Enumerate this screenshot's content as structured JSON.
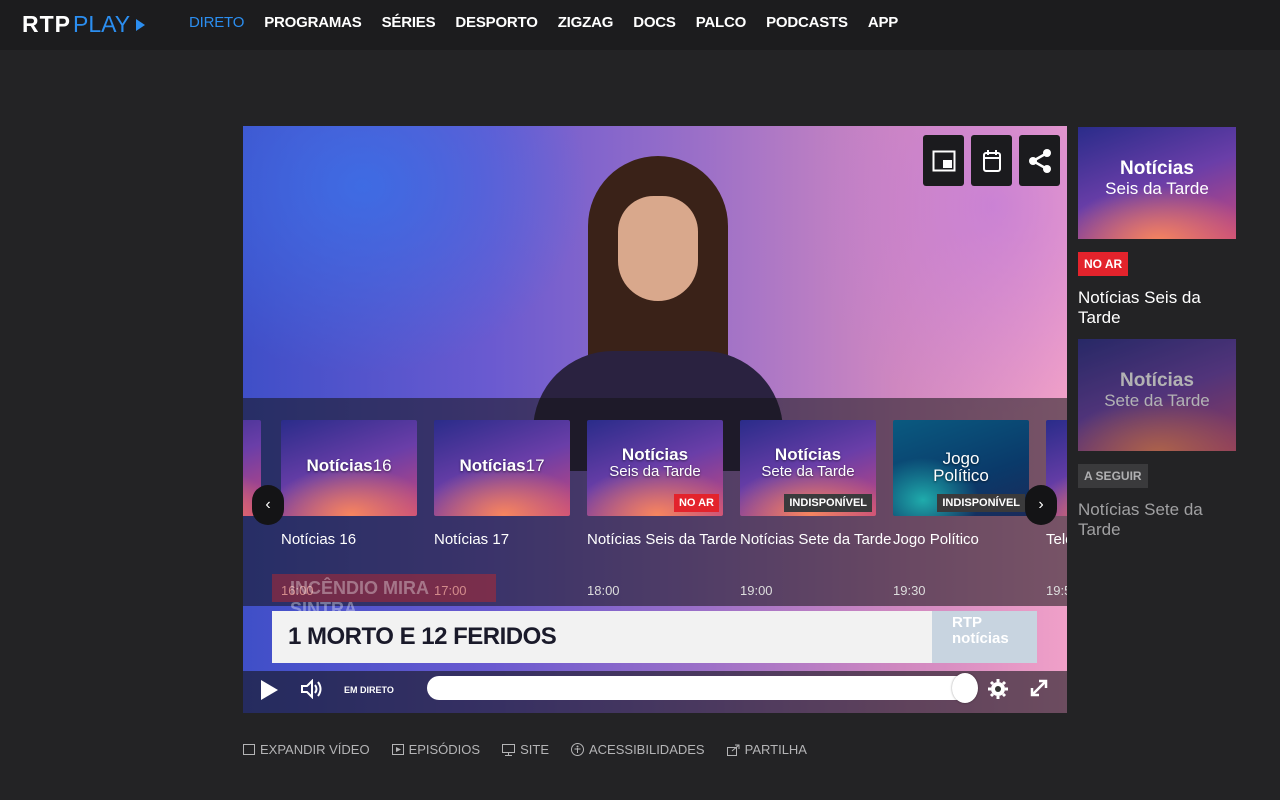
{
  "header": {
    "logo_rtp": "RTP",
    "logo_play": "PLAY",
    "nav": [
      {
        "label": "DIRETO"
      },
      {
        "label": "PROGRAMAS"
      },
      {
        "label": "SÉRIES"
      },
      {
        "label": "DESPORTO"
      },
      {
        "label": "ZIGZAG"
      },
      {
        "label": "DOCS"
      },
      {
        "label": "PALCO"
      },
      {
        "label": "PODCASTS"
      },
      {
        "label": "APP"
      }
    ],
    "active_nav": "DIRETO"
  },
  "player": {
    "top_icons": [
      "picture-in-picture-icon",
      "calendar-icon",
      "share-icon"
    ],
    "carousel": [
      {
        "thumb_title": "Notícias",
        "thumb_sub": "16",
        "name": "Notícias 16",
        "time": "16:00",
        "badge": ""
      },
      {
        "thumb_title": "Notícias",
        "thumb_sub": "17",
        "name": "Notícias 17",
        "time": "17:00",
        "badge": ""
      },
      {
        "thumb_title": "Notícias",
        "thumb_sub": "Seis da Tarde",
        "name": "Notícias Seis da Tarde",
        "time": "18:00",
        "badge": "NO AR"
      },
      {
        "thumb_title": "Notícias",
        "thumb_sub": "Sete da Tarde",
        "name": "Notícias Sete da Tarde",
        "time": "19:00",
        "badge": "INDISPONÍVEL"
      },
      {
        "thumb_title": "Jogo",
        "thumb_sub": "Político",
        "name": "Jogo Político",
        "time": "19:30",
        "badge": "INDISPONÍVEL"
      },
      {
        "thumb_title": "",
        "thumb_sub": "",
        "name": "Tele",
        "time": "19:5",
        "badge": ""
      }
    ],
    "lower_third": {
      "headline": "1 MORTO E 12 FERIDOS",
      "channel_logo": "RTP notícias",
      "ticker_behind": "INCÊNDIO MIRA SINTRA"
    },
    "controls": {
      "live_label": "EM DIRETO",
      "progress": 1.0
    }
  },
  "below_links": [
    {
      "label": "EXPANDIR VÍDEO",
      "icon": "expand-icon"
    },
    {
      "label": "EPISÓDIOS",
      "icon": "episodes-icon"
    },
    {
      "label": "SITE",
      "icon": "monitor-icon"
    },
    {
      "label": "ACESSIBILIDADES",
      "icon": "accessibility-icon"
    },
    {
      "label": "PARTILHA",
      "icon": "share-icon"
    }
  ],
  "side": [
    {
      "thumb_title": "Notícias",
      "thumb_sub": "Seis da Tarde",
      "badge": "NO AR",
      "name": "Notícias Seis da Tarde"
    },
    {
      "thumb_title": "Notícias",
      "thumb_sub": "Sete da Tarde",
      "badge": "A SEGUIR",
      "name": "Notícias Sete da Tarde"
    }
  ],
  "colors": {
    "accent": "#2b8ef0",
    "live_red": "#e3232c",
    "background": "#232325"
  }
}
